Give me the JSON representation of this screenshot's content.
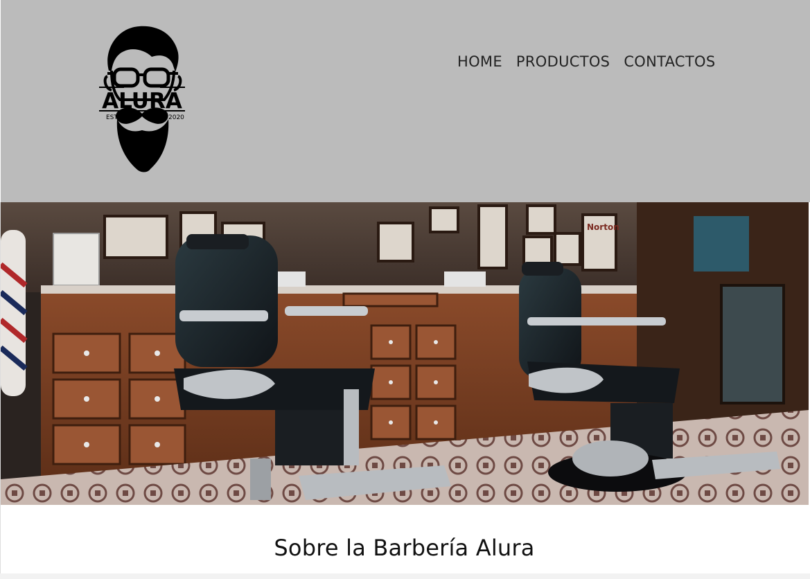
{
  "header": {
    "logo": {
      "brand": "ALURA",
      "estd_label": "ESTD",
      "year": "2020",
      "icon": "bearded-man-logo-icon"
    },
    "nav": [
      {
        "label": "HOME"
      },
      {
        "label": "PRODUCTOS"
      },
      {
        "label": "CONTACTOS"
      }
    ]
  },
  "banner": {
    "icon": "barbershop-interior-photo",
    "sign_text": "Norton"
  },
  "about": {
    "title": "Sobre la Barbería Alura"
  },
  "colors": {
    "header_bg": "#bbbbbb",
    "text": "#222222",
    "page_bg": "#ffffff"
  }
}
